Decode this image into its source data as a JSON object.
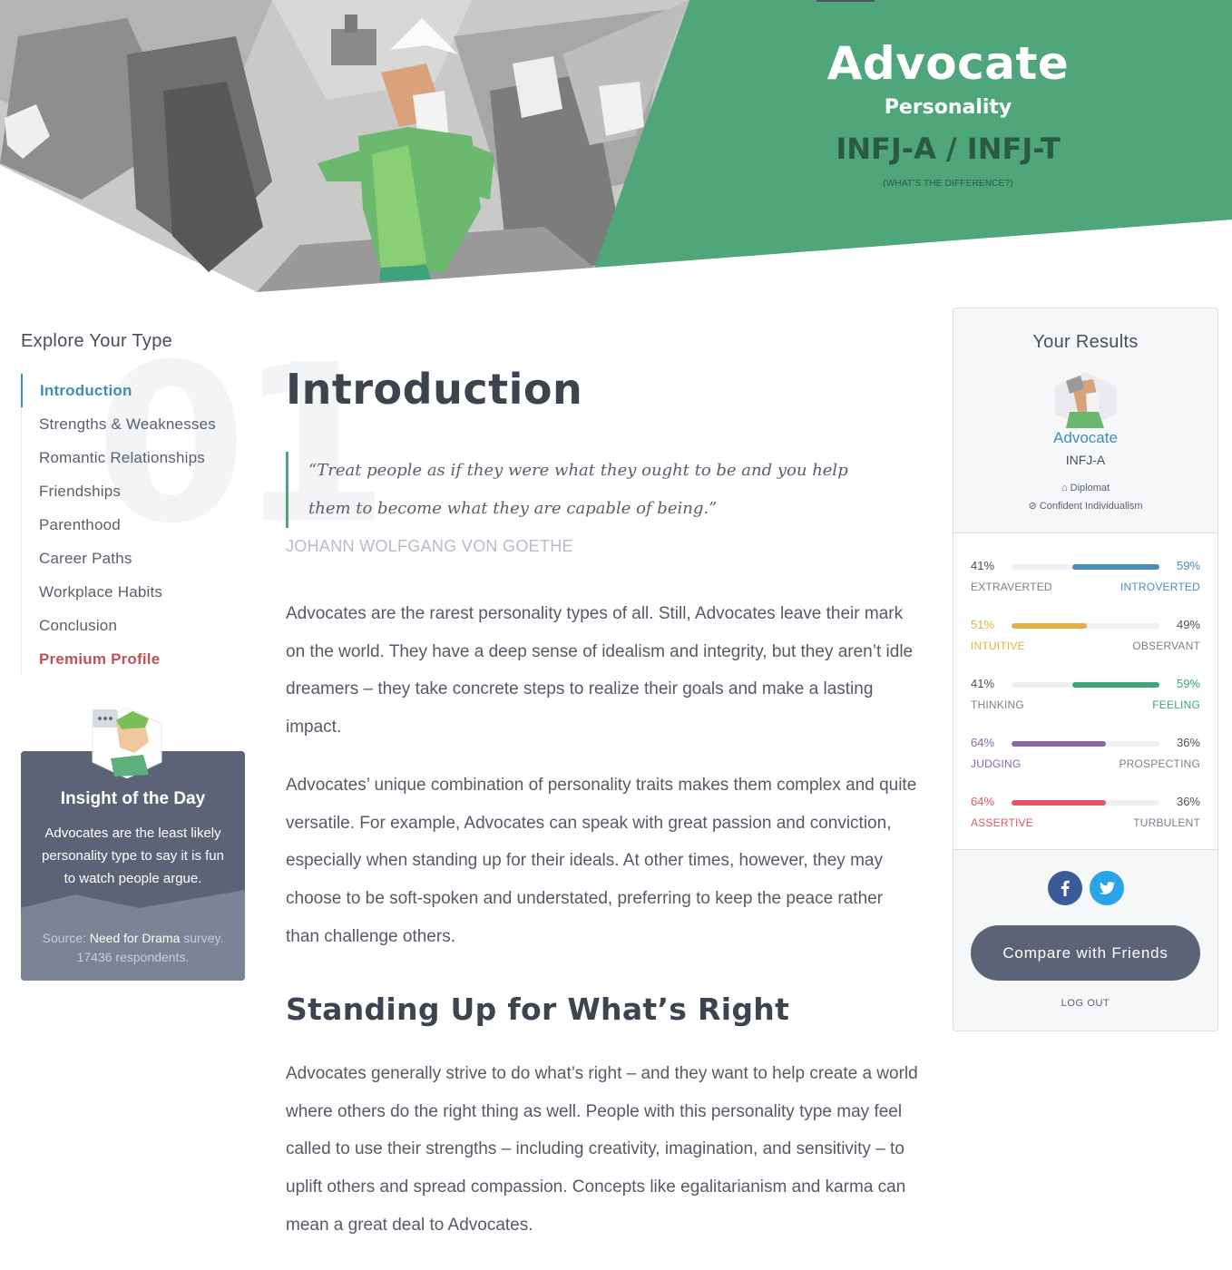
{
  "hero": {
    "title": "Advocate",
    "subtitle": "Personality",
    "codes": "INFJ-A / INFJ-T",
    "difference_link": "(WHAT'S THE DIFFERENCE?)",
    "accent": "#4ea67a"
  },
  "sidebar": {
    "title": "Explore Your Type",
    "section_number": "01",
    "items": [
      {
        "label": "Introduction",
        "active": true
      },
      {
        "label": "Strengths & Weaknesses"
      },
      {
        "label": "Romantic Relationships"
      },
      {
        "label": "Friendships"
      },
      {
        "label": "Parenthood"
      },
      {
        "label": "Career Paths"
      },
      {
        "label": "Workplace Habits"
      },
      {
        "label": "Conclusion"
      },
      {
        "label": "Premium Profile",
        "premium": true
      }
    ]
  },
  "insight": {
    "title": "Insight of the Day",
    "text": "Advocates are the least likely personality type to say it is fun to watch people argue.",
    "source_prefix": "Source: ",
    "source_name": "Need for Drama",
    "source_suffix": " survey.",
    "respondents": "17436 respondents."
  },
  "main": {
    "heading": "Introduction",
    "quote": "“Treat people as if they were what they ought to be and you help them to become what they are capable of being.”",
    "quote_author": "JOHANN WOLFGANG VON GOETHE",
    "paragraph1": "Advocates are the rarest personality types of all. Still, Advocates leave their mark on the world. They have a deep sense of idealism and integrity, but they aren’t idle dreamers – they take concrete steps to realize their goals and make a lasting impact.",
    "paragraph2": "Advocates’ unique combination of personality traits makes them complex and quite versatile. For example, Advocates can speak with great passion and conviction, especially when standing up for their ideals. At other times, however, they may choose to be soft-spoken and understated, preferring to keep the peace rather than challenge others.",
    "heading2": "Standing Up for What’s Right",
    "paragraph3": "Advocates generally strive to do what’s right – and they want to help create a world where others do the right thing as well. People with this personality type may feel called to use their strengths – including creativity, imagination, and sensitivity – to uplift others and spread compassion. Concepts like egalitarianism and karma can mean a great deal to Advocates."
  },
  "results": {
    "title": "Your Results",
    "type_name": "Advocate",
    "type_code": "INFJ-A",
    "role": "Diplomat",
    "strategy": "Confident Individualism",
    "traits": [
      {
        "left_pct": "41%",
        "right_pct": "59%",
        "left_label": "EXTRAVERTED",
        "right_label": "INTROVERTED",
        "dominant": "right",
        "value": 0.59,
        "color": "#4b8fb8"
      },
      {
        "left_pct": "51%",
        "right_pct": "49%",
        "left_label": "INTUITIVE",
        "right_label": "OBSERVANT",
        "dominant": "left",
        "value": 0.51,
        "color": "#e0b043"
      },
      {
        "left_pct": "41%",
        "right_pct": "59%",
        "left_label": "THINKING",
        "right_label": "FEELING",
        "dominant": "right",
        "value": 0.59,
        "color": "#3fa57a"
      },
      {
        "left_pct": "64%",
        "right_pct": "36%",
        "left_label": "JUDGING",
        "right_label": "PROSPECTING",
        "dominant": "left",
        "value": 0.64,
        "color": "#8a66a8"
      },
      {
        "left_pct": "64%",
        "right_pct": "36%",
        "left_label": "ASSERTIVE",
        "right_label": "TURBULENT",
        "dominant": "left",
        "value": 0.64,
        "color": "#e0566a"
      }
    ],
    "compare_button": "Compare with Friends",
    "logout": "LOG OUT"
  }
}
